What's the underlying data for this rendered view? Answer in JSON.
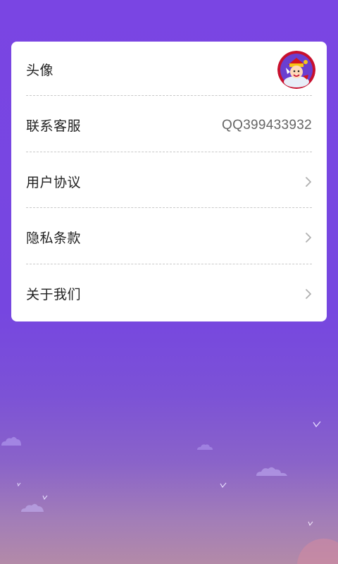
{
  "settings": {
    "items": [
      {
        "label": "头像",
        "type": "avatar",
        "icon": "avatar-image"
      },
      {
        "label": "联系客服",
        "type": "value",
        "value": "QQ399433932"
      },
      {
        "label": "用户协议",
        "type": "link",
        "icon": "chevron-right-icon"
      },
      {
        "label": "隐私条款",
        "type": "link",
        "icon": "chevron-right-icon"
      },
      {
        "label": "关于我们",
        "type": "link",
        "icon": "chevron-right-icon"
      }
    ]
  },
  "colors": {
    "background": "#7a45e3",
    "card": "#ffffff",
    "label_text": "#222222",
    "value_text": "#666666",
    "chevron": "#b0b0b0"
  }
}
